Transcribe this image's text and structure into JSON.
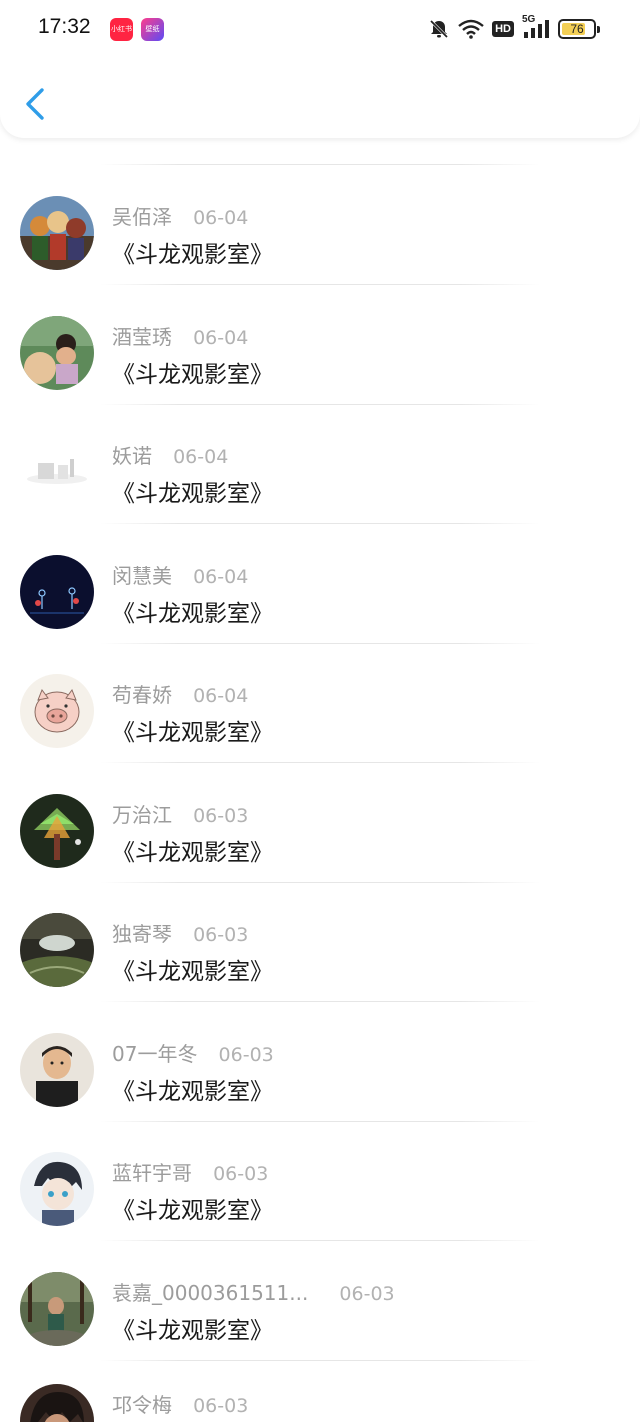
{
  "status_bar": {
    "time": "17:32",
    "app_badges": [
      {
        "label": "小红书",
        "color": "#ff2442"
      },
      {
        "label": "壁纸",
        "color": "#5b4bf5"
      }
    ],
    "icons": [
      "bell-muted-icon",
      "wifi-icon",
      "hd-icon",
      "signal-5g-icon"
    ],
    "hd_label": "HD",
    "network_label": "5G",
    "battery_level": "76",
    "battery_color": "#f3cf55"
  },
  "header": {
    "back_icon": "chevron-left-icon",
    "accent_color": "#2f9de8"
  },
  "list": {
    "items": [
      {
        "name": "",
        "date": "",
        "message": "",
        "avatar": "partial-avatar"
      },
      {
        "name": "吴佰泽",
        "date": "06-04",
        "message": "《斗龙观影室》",
        "avatar": "anime-group-avatar"
      },
      {
        "name": "酒莹琇",
        "date": "06-04",
        "message": "《斗龙观影室》",
        "avatar": "girl-photo-avatar"
      },
      {
        "name": "妖诺",
        "date": "06-04",
        "message": "《斗龙观影室》",
        "avatar": "gray-sketch-avatar"
      },
      {
        "name": "闵慧美",
        "date": "06-04",
        "message": "《斗龙观影室》",
        "avatar": "dark-figures-avatar"
      },
      {
        "name": "苟春娇",
        "date": "06-04",
        "message": "《斗龙观影室》",
        "avatar": "pig-cartoon-avatar"
      },
      {
        "name": "万治江",
        "date": "06-03",
        "message": "《斗龙观影室》",
        "avatar": "glowing-tree-avatar"
      },
      {
        "name": "独寄琴",
        "date": "06-03",
        "message": "《斗龙观影室》",
        "avatar": "landscape-avatar"
      },
      {
        "name": "07一年冬",
        "date": "06-03",
        "message": "《斗龙观影室》",
        "avatar": "boy-photo-avatar"
      },
      {
        "name": "蓝轩宇哥",
        "date": "06-03",
        "message": "《斗龙观影室》",
        "avatar": "anime-boy-avatar"
      },
      {
        "name": "袁嘉_0000361511...",
        "date": "06-03",
        "message": "《斗龙观影室》",
        "avatar": "outdoor-photo-avatar"
      },
      {
        "name": "邛令梅",
        "date": "06-03",
        "message": "",
        "avatar": "dark-hair-avatar"
      }
    ]
  }
}
